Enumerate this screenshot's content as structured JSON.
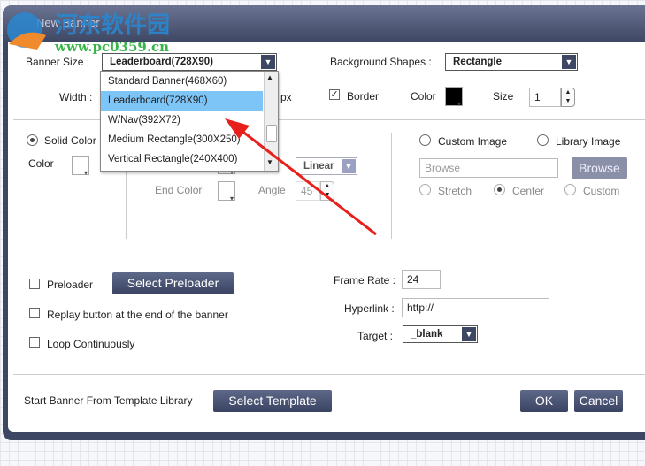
{
  "window": {
    "title": "New Banner"
  },
  "watermark": {
    "name": "河东软件园",
    "url": "www.pc0359.cn"
  },
  "general": {
    "banner_size_label": "Banner Size  :",
    "banner_size_value": "Leaderboard(728X90)",
    "banner_size_options": [
      "Standard Banner(468X60)",
      "Leaderboard(728X90)",
      "W/Nav(392X72)",
      "Medium Rectangle(300X250)",
      "Vertical Rectangle(240X400)"
    ],
    "background_shapes_label": "Background Shapes  :",
    "background_shapes_value": "Rectangle",
    "width_label": "Width :",
    "px_label": "px",
    "border_label": "Border",
    "border_checked": true,
    "color_label": "Color",
    "border_color": "#000000",
    "size_label": "Size",
    "size_value": "1"
  },
  "fill": {
    "solid_color_label": "Solid Color",
    "solid_selected": true,
    "color_label": "Color",
    "gradient_type": "Linear",
    "end_color_label": "End Color",
    "angle_label": "Angle",
    "angle_value": "45"
  },
  "image": {
    "custom_image_label": "Custom Image",
    "library_image_label": "Library Image",
    "browse_placeholder": "Browse",
    "browse_button": "Browse",
    "stretch_label": "Stretch",
    "center_label": "Center",
    "custom_label": "Custom",
    "selected_fit": "Center"
  },
  "options": {
    "preloader_label": "Preloader",
    "select_preloader": "Select Preloader",
    "replay_label": "Replay button at the end of the banner",
    "loop_label": "Loop Continuously",
    "frame_rate_label": "Frame Rate :",
    "frame_rate_value": "24",
    "hyperlink_label": "Hyperlink :",
    "hyperlink_value": "http://",
    "target_label": "Target :",
    "target_value": "_blank"
  },
  "footer": {
    "template_label": "Start Banner From Template Library",
    "select_template": "Select Template",
    "ok": "OK",
    "cancel": "Cancel"
  },
  "colors": {
    "frame": "#3d4663",
    "highlight": "#7dc4f7",
    "annotation_arrow": "#e8201c"
  }
}
